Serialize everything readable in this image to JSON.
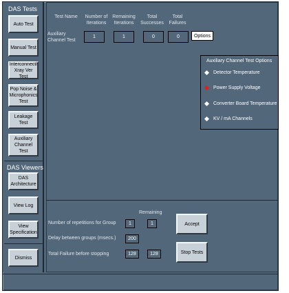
{
  "das_tests": {
    "header": "DAS Tests",
    "buttons": [
      "Auto Test",
      "Manual Test",
      "Interconnect/ Xray Ver Test",
      "Pop Noise & Microphonics Test",
      "Leakage Test",
      "Auxiliary Channel Test"
    ]
  },
  "das_viewers": {
    "header": "DAS Viewers",
    "buttons": [
      "DAS Architecture",
      "View Log",
      "View Specification",
      "Dismiss"
    ]
  },
  "table": {
    "headers": {
      "test_name": "Test Name",
      "iterations": "Number of Iterations",
      "remaining": "Remaining Iterations",
      "successes": "Total Successes",
      "failures": "Total Failures"
    },
    "row": {
      "name": "Auxiliary Channel Test",
      "iterations": "1",
      "remaining": "1",
      "successes": "0",
      "failures": "0"
    },
    "options_label": "Options"
  },
  "options_popup": {
    "title": "Auxiliary Channel Test Options",
    "items": [
      {
        "label": "Detector Temperature",
        "selected": false
      },
      {
        "label": "Power Supply Voltage",
        "selected": true
      },
      {
        "label": "Converter Board Temperature",
        "selected": false
      },
      {
        "label": "KV / mA Channels",
        "selected": false
      }
    ],
    "colors": {
      "selected": "#e02020",
      "unselected": "#ffffff"
    }
  },
  "bottom": {
    "remaining_label": "Remaining",
    "repetitions_label": "Number of repetitions for Group",
    "repetitions_value": "1",
    "repetitions_remaining": "1",
    "delay_label": "Delay between groups (msecs.)",
    "delay_value": "200",
    "failure_label": "Total Failure before stopping",
    "failure_value": "128",
    "failure_remaining": "128",
    "accept_label": "Accept",
    "stop_label": "Stop Tests"
  }
}
